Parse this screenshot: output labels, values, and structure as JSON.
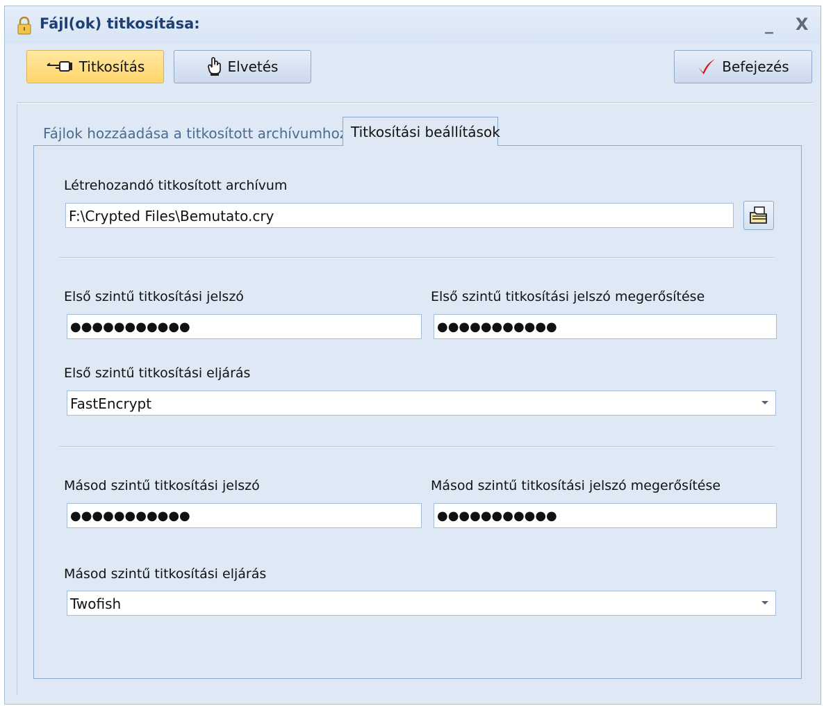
{
  "window": {
    "title": "Fájl(ok) titkosítása:",
    "minimize": "_",
    "close": "X"
  },
  "toolbar": {
    "encrypt_label": "Titkosítás",
    "discard_label": "Elvetés",
    "finish_label": "Befejezés"
  },
  "tabs": [
    {
      "label": "Fájlok hozzáadása a titkosított archívumhoz",
      "active": false
    },
    {
      "label": "Titkosítási beállítások",
      "active": true
    }
  ],
  "form": {
    "archive_label": "Létrehozandó titkosított archívum",
    "archive_path": "F:\\Crypted Files\\Bemutato.cry",
    "level1": {
      "password_label": "Első szintű titkosítási jelszó",
      "password_value": "●●●●●●●●●●●",
      "confirm_label": "Első szintű titkosítási jelszó megerősítése",
      "confirm_value": "●●●●●●●●●●●",
      "method_label": "Első szintű titkosítási eljárás",
      "method_value": "FastEncrypt"
    },
    "level2": {
      "password_label": "Másod szintű titkosítási jelszó",
      "password_value": "●●●●●●●●●●●",
      "confirm_label": "Másod szintű titkosítási jelszó megerősítése",
      "confirm_value": "●●●●●●●●●●●",
      "method_label": "Másod szintű titkosítási eljárás",
      "method_value": "Twofish"
    }
  },
  "icons": {
    "title": "lock-icon",
    "encrypt": "pointing-hand-icon",
    "discard": "raised-hand-icon",
    "finish": "checkmark-icon",
    "browse": "folder-open-icon"
  },
  "colors": {
    "window_bg": "#dfe9f6",
    "active_button": "#ffd46a",
    "checkmark": "#e0101a",
    "title_text": "#1d3f72"
  }
}
